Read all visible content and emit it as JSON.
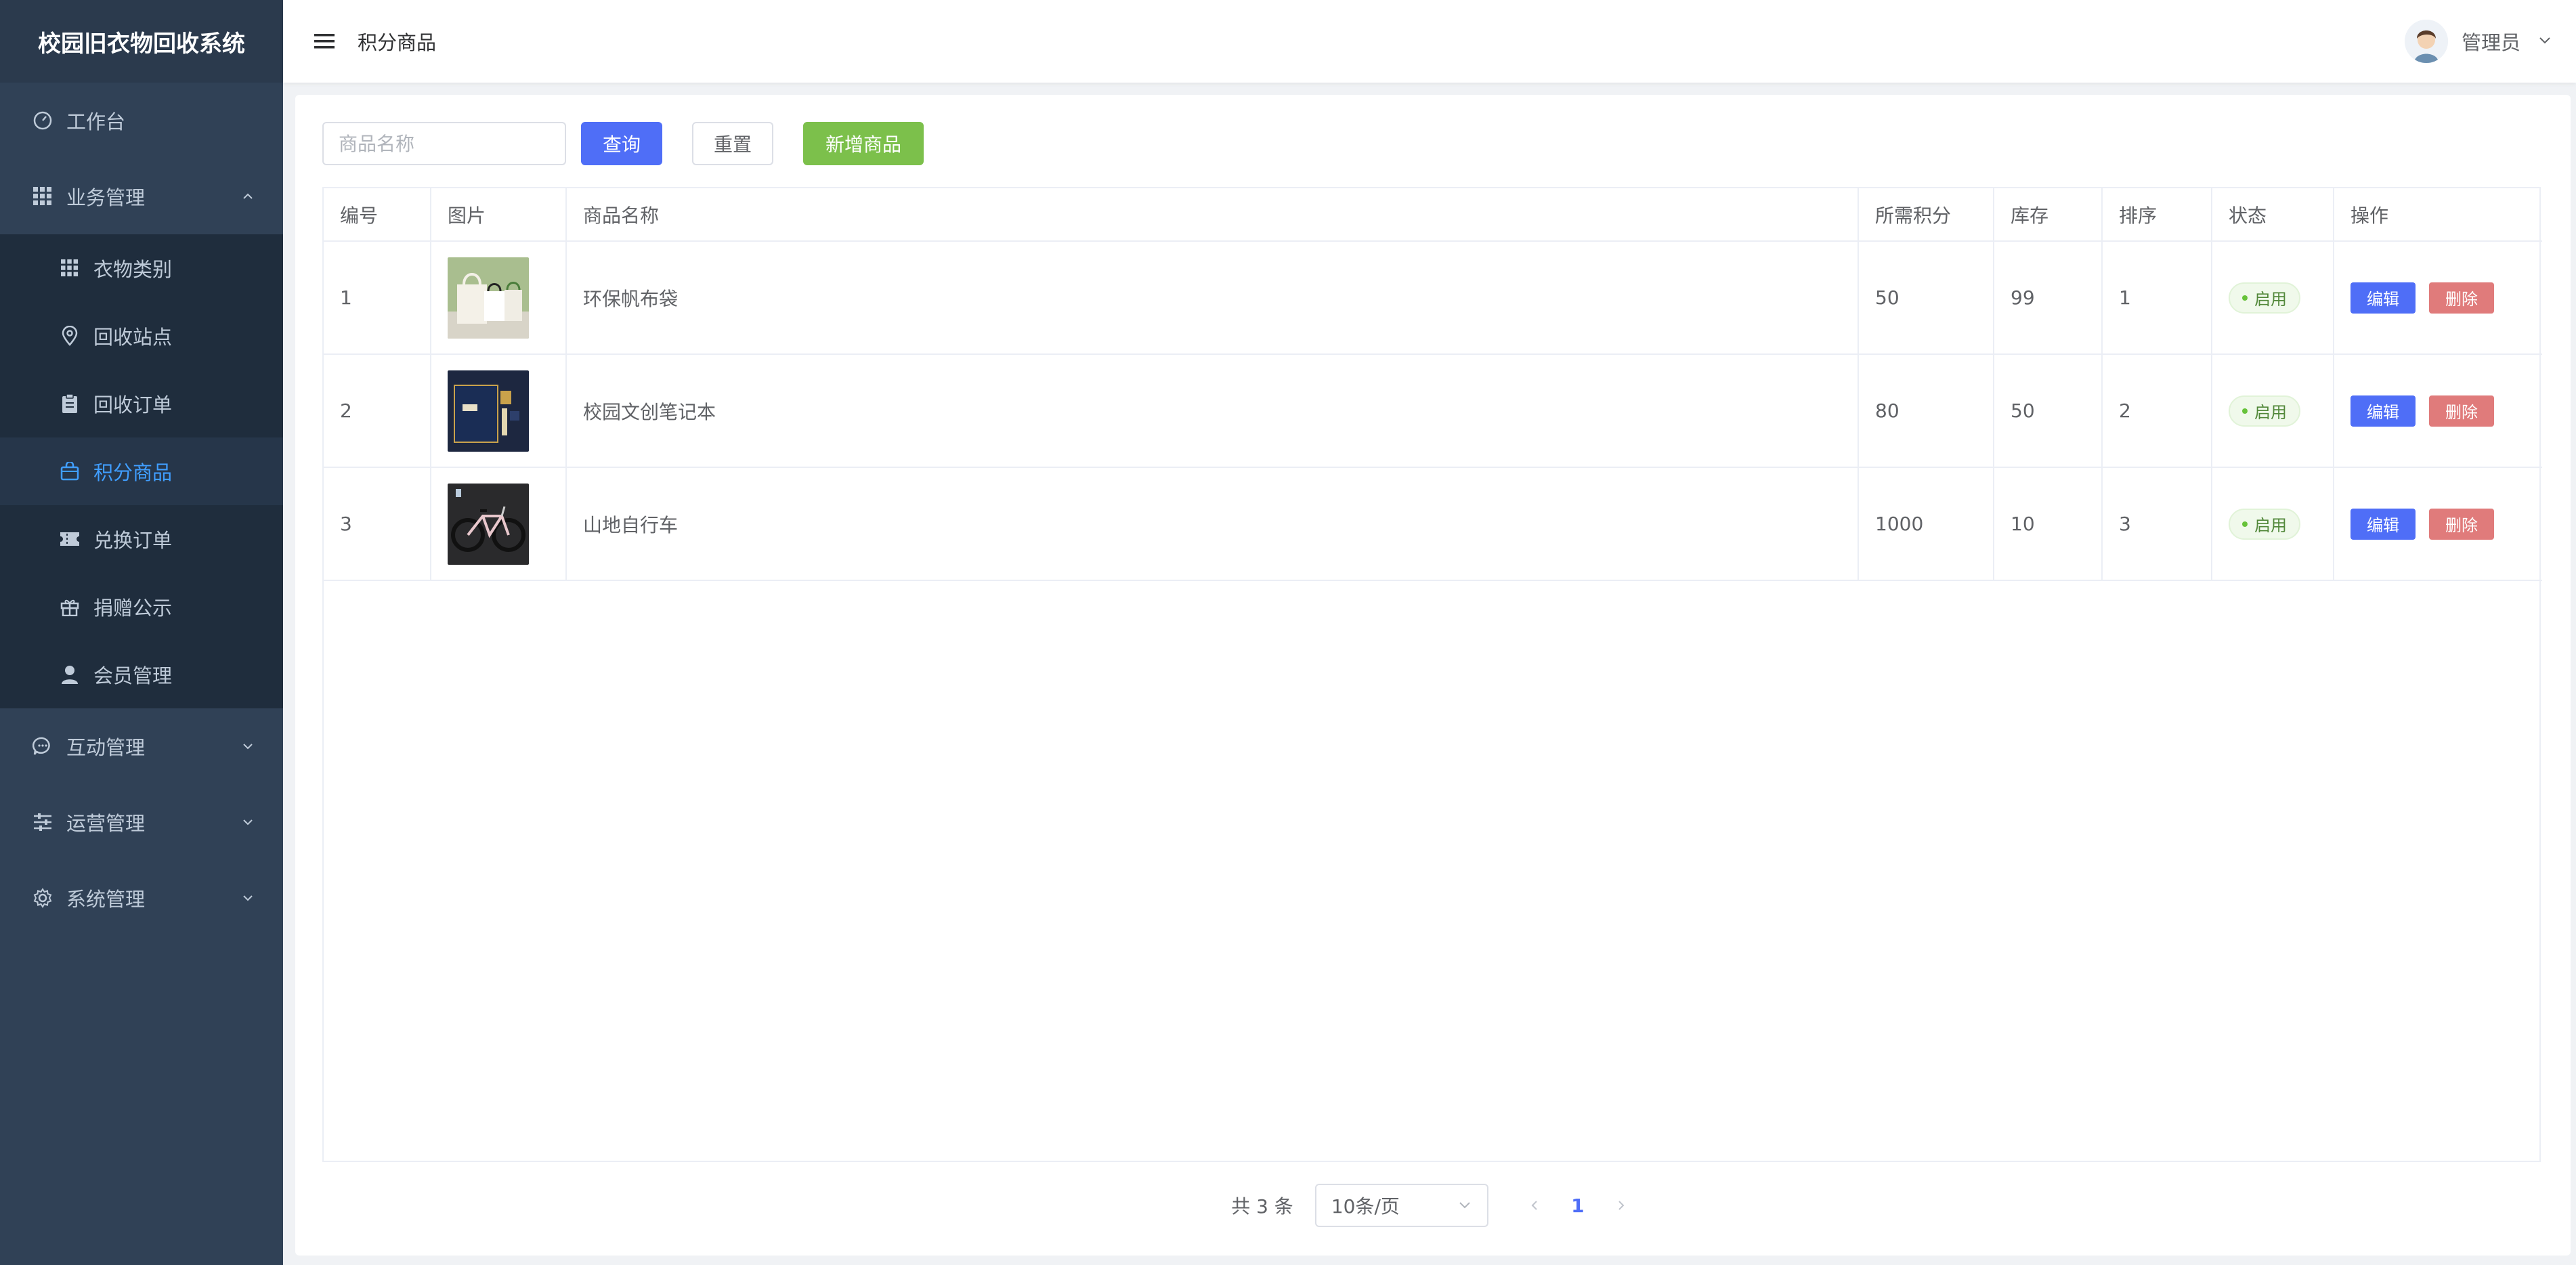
{
  "app": {
    "title": "校园旧衣物回收系统"
  },
  "sidebar": {
    "items": [
      {
        "label": "工作台",
        "icon": "dashboard-icon"
      },
      {
        "label": "业务管理",
        "icon": "grid-icon",
        "expanded": true,
        "children": [
          {
            "label": "衣物类别",
            "icon": "grid-icon"
          },
          {
            "label": "回收站点",
            "icon": "location-icon"
          },
          {
            "label": "回收订单",
            "icon": "clipboard-icon"
          },
          {
            "label": "积分商品",
            "icon": "bag-icon",
            "active": true
          },
          {
            "label": "兑换订单",
            "icon": "ticket-icon"
          },
          {
            "label": "捐赠公示",
            "icon": "gift-icon"
          },
          {
            "label": "会员管理",
            "icon": "user-icon"
          }
        ]
      },
      {
        "label": "互动管理",
        "icon": "chat-icon"
      },
      {
        "label": "运营管理",
        "icon": "sliders-icon"
      },
      {
        "label": "系统管理",
        "icon": "gear-icon"
      }
    ]
  },
  "header": {
    "breadcrumb": "积分商品",
    "user": "管理员"
  },
  "toolbar": {
    "search_placeholder": "商品名称",
    "search_value": "",
    "query_label": "查询",
    "reset_label": "重置",
    "add_label": "新增商品"
  },
  "table": {
    "columns": [
      "编号",
      "图片",
      "商品名称",
      "所需积分",
      "库存",
      "排序",
      "状态",
      "操作"
    ],
    "rows": [
      {
        "id": "1",
        "name": "环保帆布袋",
        "points": "50",
        "stock": "99",
        "sort": "1",
        "status": "启用",
        "edit": "编辑",
        "delete": "删除"
      },
      {
        "id": "2",
        "name": "校园文创笔记本",
        "points": "80",
        "stock": "50",
        "sort": "2",
        "status": "启用",
        "edit": "编辑",
        "delete": "删除"
      },
      {
        "id": "3",
        "name": "山地自行车",
        "points": "1000",
        "stock": "10",
        "sort": "3",
        "status": "启用",
        "edit": "编辑",
        "delete": "删除"
      }
    ]
  },
  "pagination": {
    "total": "共 3 条",
    "page_size": "10条/页",
    "current_page": "1"
  },
  "colors": {
    "sidebar_bg": "#304156",
    "active": "#409eff",
    "primary": "#4f6ef7",
    "success": "#7cc04b",
    "danger": "#e07b7b"
  }
}
